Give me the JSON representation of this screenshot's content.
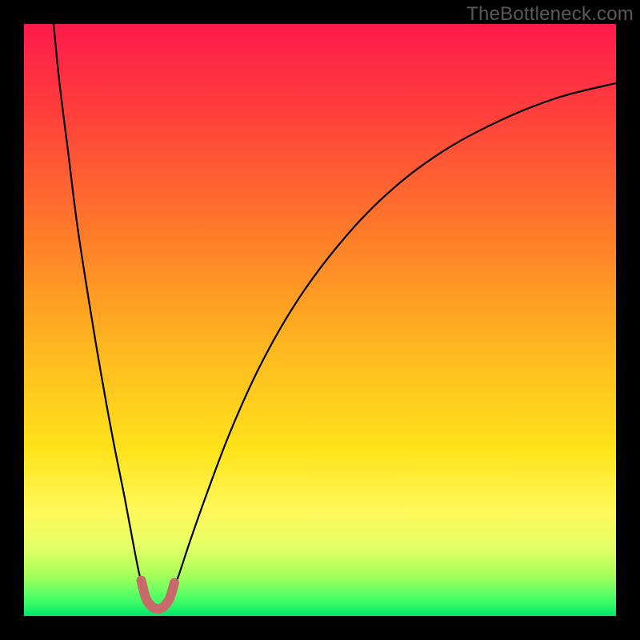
{
  "watermark": "TheBottleneck.com",
  "chart_data": {
    "type": "line",
    "title": "",
    "xlabel": "",
    "ylabel": "",
    "xlim": [
      0,
      100
    ],
    "ylim": [
      0,
      100
    ],
    "grid": false,
    "legend": false,
    "background_gradient": {
      "stops": [
        {
          "offset": 0.0,
          "color": "#ff1a4b"
        },
        {
          "offset": 0.15,
          "color": "#ff3f3c"
        },
        {
          "offset": 0.35,
          "color": "#ff7a2a"
        },
        {
          "offset": 0.55,
          "color": "#ffb81f"
        },
        {
          "offset": 0.72,
          "color": "#ffe31a"
        },
        {
          "offset": 0.82,
          "color": "#fff85a"
        },
        {
          "offset": 0.88,
          "color": "#e8ff66"
        },
        {
          "offset": 0.93,
          "color": "#a8ff5a"
        },
        {
          "offset": 0.97,
          "color": "#4dff66"
        },
        {
          "offset": 1.0,
          "color": "#00e86b"
        }
      ]
    },
    "series": [
      {
        "name": "bottleneck-curve",
        "stroke": "#000000",
        "stroke_width": 2.2,
        "points": [
          {
            "x": 5.0,
            "y": 100.0
          },
          {
            "x": 6.0,
            "y": 90.0
          },
          {
            "x": 7.5,
            "y": 78.0
          },
          {
            "x": 9.0,
            "y": 66.0
          },
          {
            "x": 11.0,
            "y": 53.0
          },
          {
            "x": 13.0,
            "y": 41.0
          },
          {
            "x": 15.0,
            "y": 30.0
          },
          {
            "x": 17.0,
            "y": 20.0
          },
          {
            "x": 18.5,
            "y": 12.0
          },
          {
            "x": 19.5,
            "y": 7.0
          },
          {
            "x": 20.5,
            "y": 3.5
          },
          {
            "x": 21.5,
            "y": 1.8
          },
          {
            "x": 22.5,
            "y": 1.2
          },
          {
            "x": 23.5,
            "y": 1.6
          },
          {
            "x": 24.5,
            "y": 3.0
          },
          {
            "x": 26.0,
            "y": 6.5
          },
          {
            "x": 28.0,
            "y": 12.5
          },
          {
            "x": 31.0,
            "y": 21.0
          },
          {
            "x": 35.0,
            "y": 31.5
          },
          {
            "x": 40.0,
            "y": 42.5
          },
          {
            "x": 46.0,
            "y": 53.0
          },
          {
            "x": 53.0,
            "y": 62.5
          },
          {
            "x": 61.0,
            "y": 71.0
          },
          {
            "x": 70.0,
            "y": 78.0
          },
          {
            "x": 80.0,
            "y": 83.5
          },
          {
            "x": 90.0,
            "y": 87.5
          },
          {
            "x": 100.0,
            "y": 90.0
          }
        ]
      },
      {
        "name": "trough-marker",
        "stroke": "#c96a6a",
        "stroke_width": 12,
        "linecap": "round",
        "points": [
          {
            "x": 19.8,
            "y": 6.0
          },
          {
            "x": 20.6,
            "y": 3.0
          },
          {
            "x": 21.6,
            "y": 1.6
          },
          {
            "x": 22.6,
            "y": 1.2
          },
          {
            "x": 23.6,
            "y": 1.6
          },
          {
            "x": 24.6,
            "y": 3.0
          },
          {
            "x": 25.4,
            "y": 5.6
          }
        ]
      }
    ]
  }
}
